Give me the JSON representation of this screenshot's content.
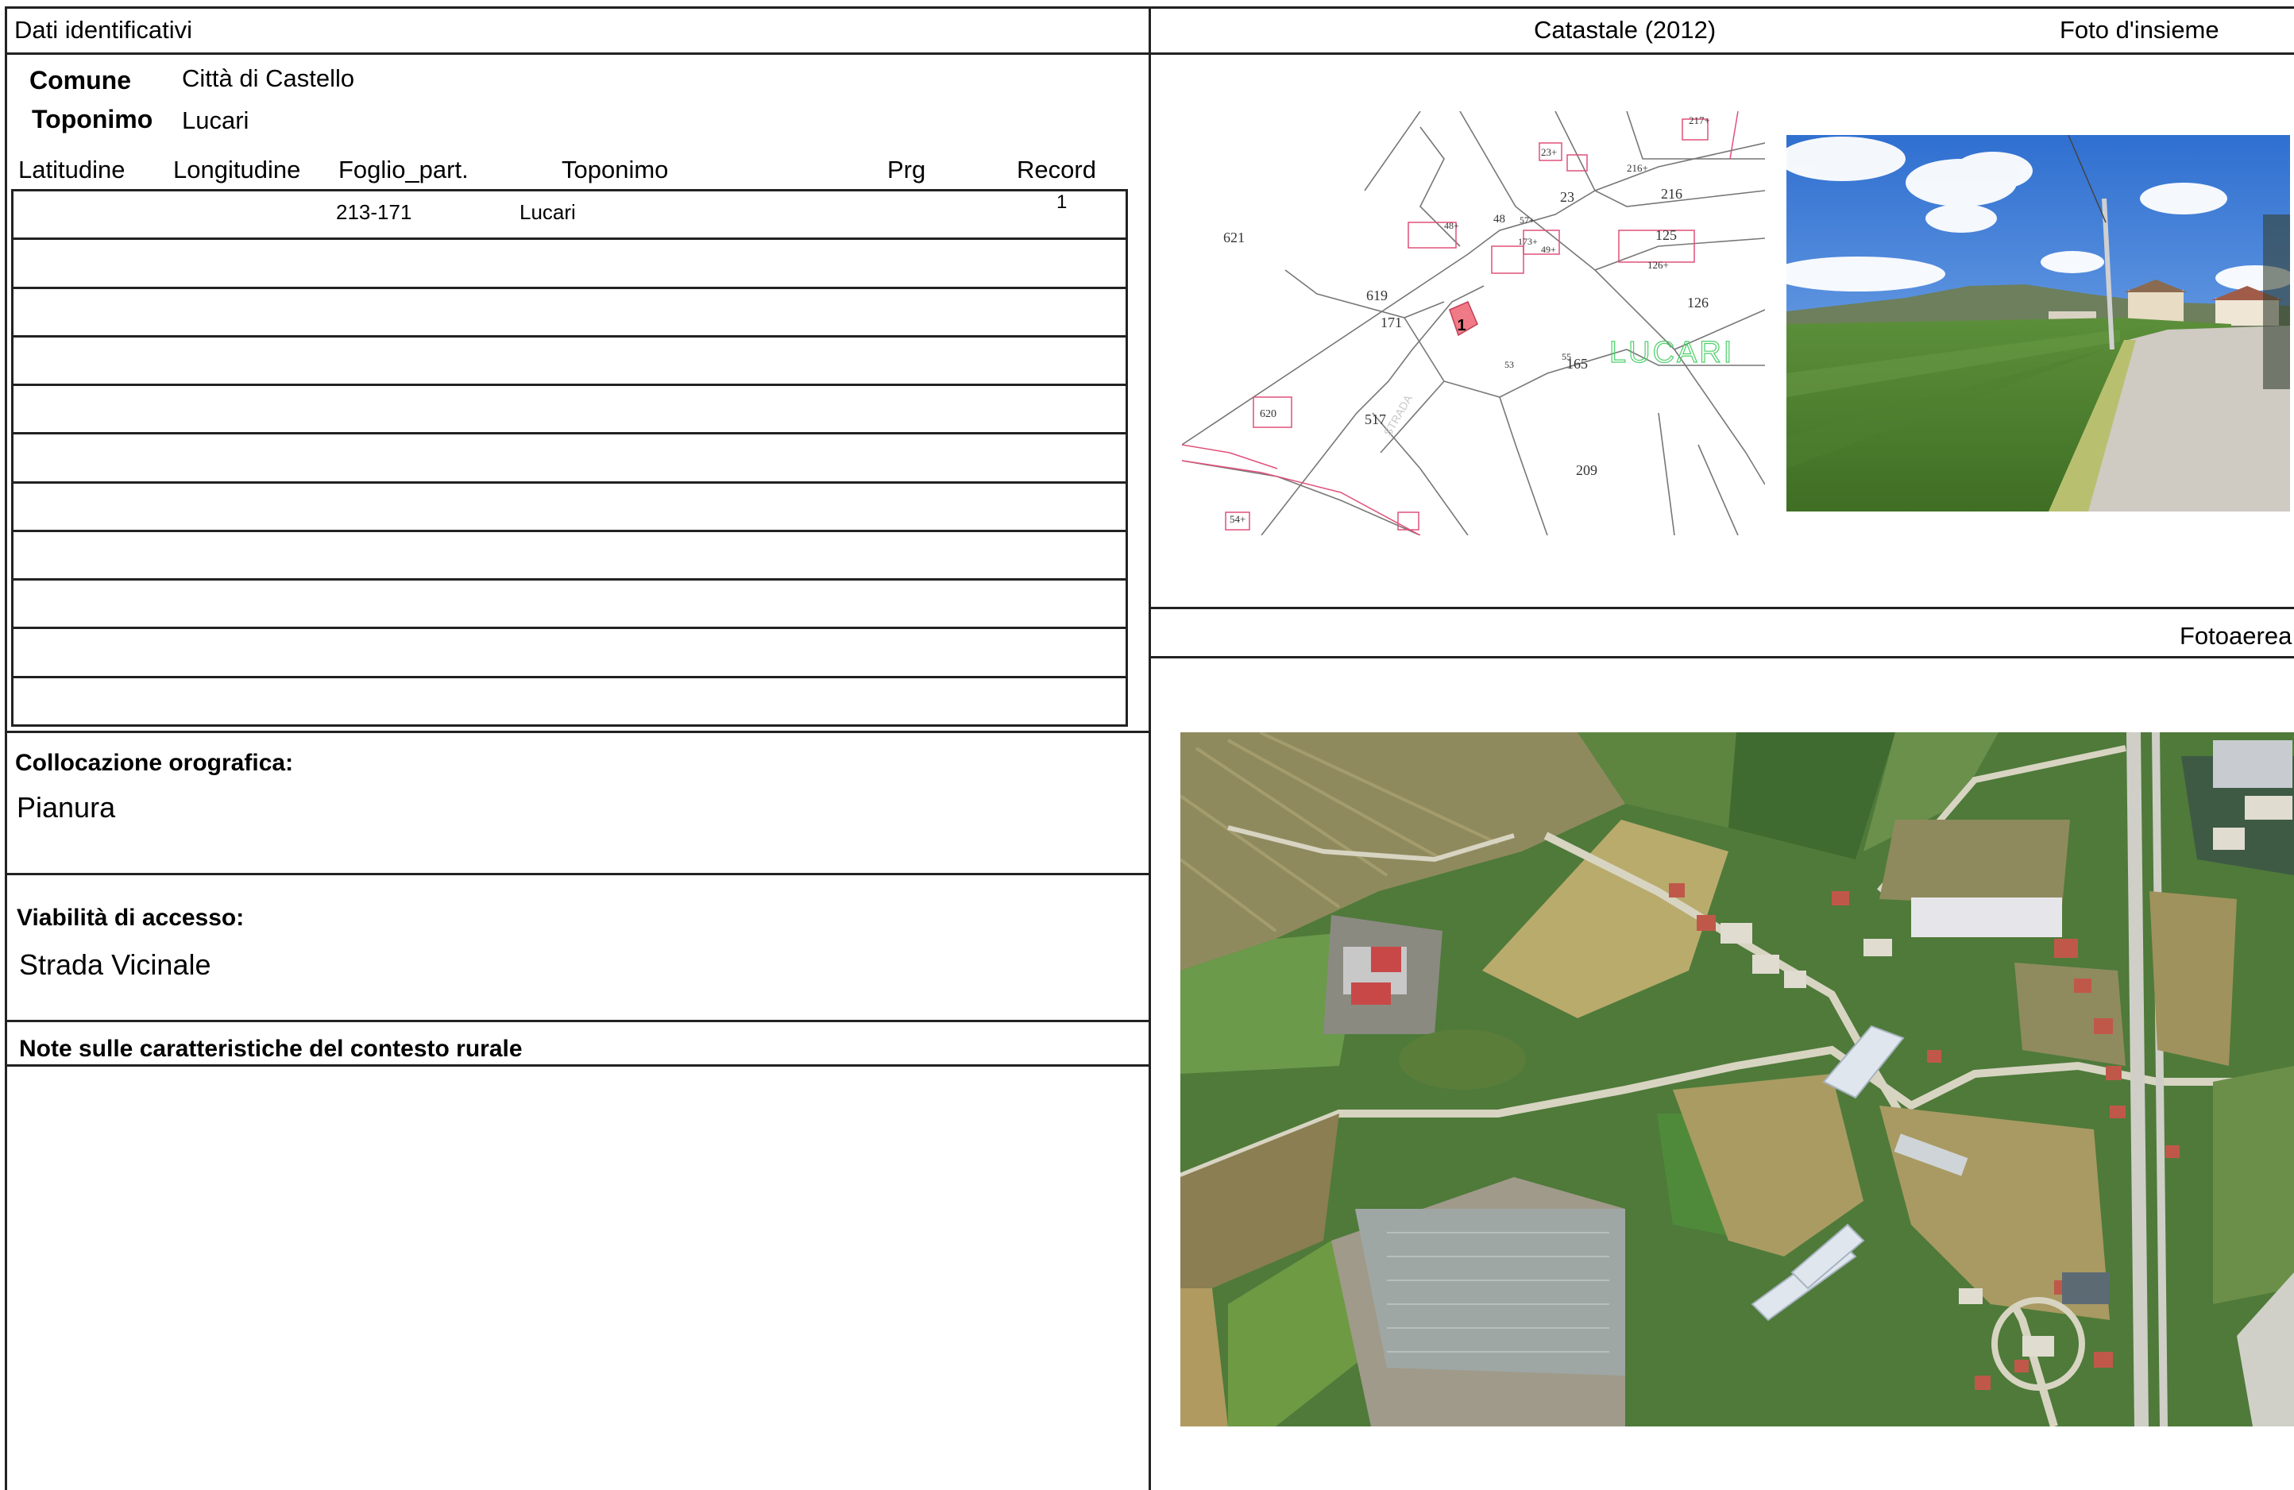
{
  "header": {
    "left_title": "Dati identificativi",
    "cadastral_title": "Catastale (2012)",
    "photo_title": "Foto d'insieme",
    "aerial_title": "Fotoaerea"
  },
  "ident": {
    "comune_label": "Comune",
    "comune_value": "Città di Castello",
    "toponimo_label": "Toponimo",
    "toponimo_value": "Lucari"
  },
  "table": {
    "columns": [
      "Latitudine",
      "Longitudine",
      "Foglio_part.",
      "Toponimo",
      "Prg",
      "Record"
    ],
    "rows": [
      {
        "latitudine": "",
        "longitudine": "",
        "foglio": "213-171",
        "toponimo": "Lucari",
        "prg": "",
        "record": "1"
      }
    ]
  },
  "orografia": {
    "label": "Collocazione orografica:",
    "value": "Pianura"
  },
  "viabilita": {
    "label": "Viabilità di accesso:",
    "value": "Strada Vicinale"
  },
  "note": {
    "label": "Note sulle caratteristiche del contesto rurale",
    "value": ""
  },
  "cadastral_map": {
    "parcel_numbers": [
      "621",
      "619",
      "171",
      "517",
      "23",
      "216",
      "125",
      "126",
      "209",
      "165",
      "48",
      "53",
      "620",
      "217+",
      "23+",
      "216+",
      "126+",
      "57+",
      "54+",
      "49+",
      "173+",
      "48+",
      "55"
    ],
    "highlight_marker": "1",
    "place_label": "LUCARI",
    "road_label": "STRADA"
  },
  "colors": {
    "border": "#222222",
    "parcel_line": "#777777",
    "parcel_pink": "#e0507a",
    "place_green": "#4cd06a",
    "marker_fill": "#f07a85"
  }
}
